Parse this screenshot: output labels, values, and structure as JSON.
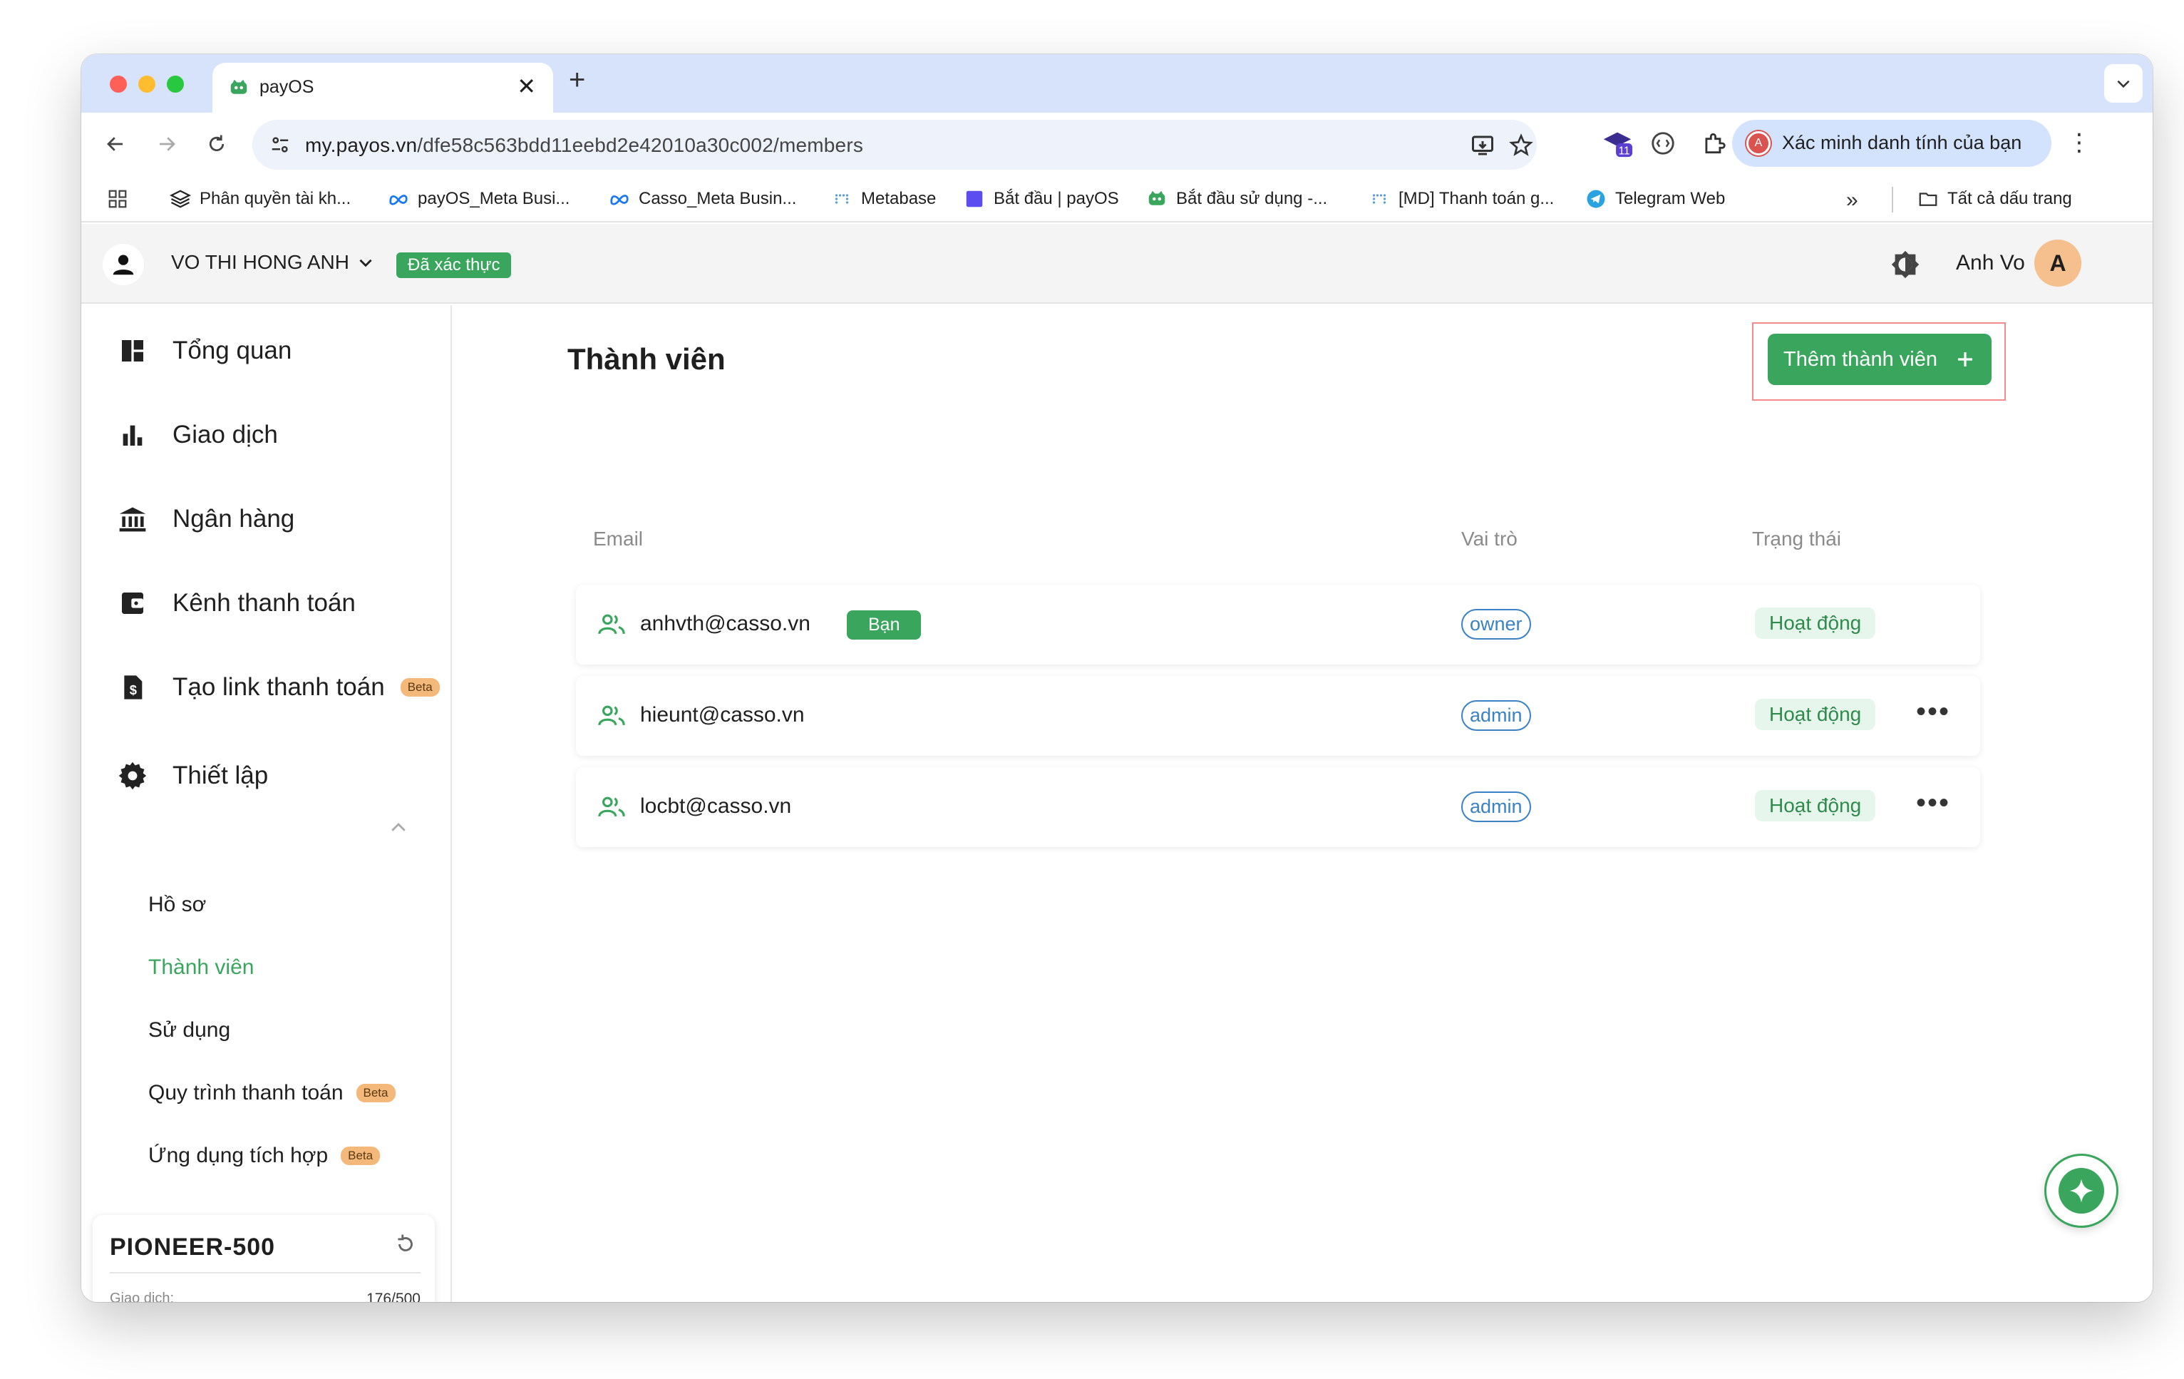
{
  "browser": {
    "tab_title": "payOS",
    "url_host": "my.payos.vn",
    "url_path": "/dfe58c563bdd11eebd2e42010a30c002/members",
    "extension_badge": "11",
    "profile_label": "Xác minh danh tính của bạn",
    "profile_initial": "A"
  },
  "bookmarks": [
    {
      "label": "Phân quyền tài kh...",
      "icon": "layers-icon"
    },
    {
      "label": "payOS_Meta Busi...",
      "icon": "meta-icon"
    },
    {
      "label": "Casso_Meta Busin...",
      "icon": "meta-icon"
    },
    {
      "label": "Metabase",
      "icon": "metabase-icon"
    },
    {
      "label": "Bắt đầu | payOS",
      "icon": "square-icon"
    },
    {
      "label": "Bắt đầu sử dụng -...",
      "icon": "payos-icon"
    },
    {
      "label": "[MD] Thanh toán g...",
      "icon": "metabase-icon"
    },
    {
      "label": "Telegram Web",
      "icon": "telegram-icon"
    }
  ],
  "bookmarks_all": "Tất cả dấu trang",
  "header": {
    "org_name": "VO THI HONG ANH",
    "verified_label": "Đã xác thực",
    "account_name": "Anh Vo",
    "account_initial": "A"
  },
  "sidebar": {
    "items": [
      {
        "label": "Tổng quan",
        "icon": "dashboard-icon"
      },
      {
        "label": "Giao dịch",
        "icon": "bar-chart-icon"
      },
      {
        "label": "Ngân hàng",
        "icon": "bank-icon"
      },
      {
        "label": "Kênh thanh toán",
        "icon": "wallet-icon"
      },
      {
        "label": "Tạo link thanh toán",
        "icon": "invoice-icon",
        "badge": "Beta"
      },
      {
        "label": "Thiết lập",
        "icon": "gear-icon"
      }
    ],
    "subitems": [
      {
        "label": "Hồ sơ"
      },
      {
        "label": "Thành viên",
        "active": true
      },
      {
        "label": "Sử dụng"
      },
      {
        "label": "Quy trình thanh toán",
        "badge": "Beta"
      },
      {
        "label": "Ứng dụng tích hợp",
        "badge": "Beta"
      }
    ],
    "plan": {
      "name": "PIONEER-500",
      "usage_label": "Giao dịch:",
      "usage_value": "176/500",
      "usage_fraction": 0.352
    }
  },
  "main": {
    "title": "Thành viên",
    "add_button_label": "Thêm thành viên",
    "columns": {
      "email": "Email",
      "role": "Vai trò",
      "status": "Trạng thái"
    },
    "members": [
      {
        "email": "anhvth@casso.vn",
        "you_badge": "Bạn",
        "role": "owner",
        "status": "Hoạt động",
        "has_menu": false
      },
      {
        "email": "hieunt@casso.vn",
        "role": "admin",
        "status": "Hoạt động",
        "has_menu": true
      },
      {
        "email": "locbt@casso.vn",
        "role": "admin",
        "status": "Hoạt động",
        "has_menu": true
      }
    ]
  },
  "colors": {
    "accent": "#3aa55d",
    "role_blue": "#3b82c4",
    "tab_strip": "#d7e3fb",
    "highlight": "#f28b8b",
    "beta": "#f4b87a"
  }
}
